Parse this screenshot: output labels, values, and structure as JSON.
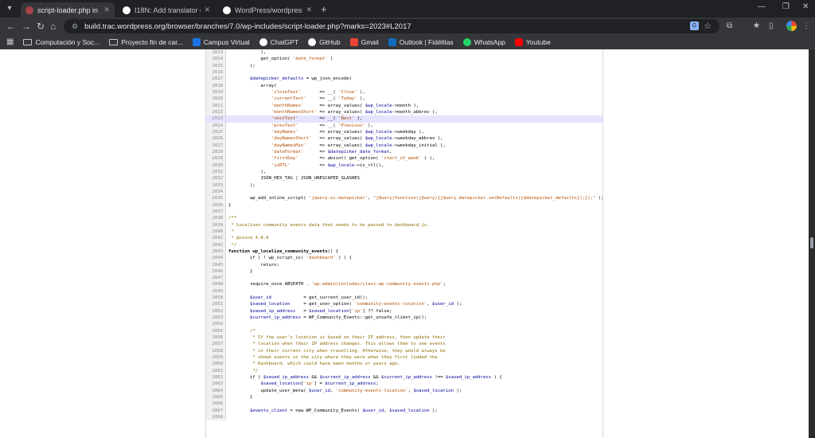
{
  "tabs": [
    {
      "title": "script-loader.php in branches/7.0/wp-includes – WordPress Trac",
      "color": "#a9434a",
      "active": true
    },
    {
      "title": "I18N: Add translator context for datepicker",
      "color": "#ffffff",
      "active": false
    },
    {
      "title": "WordPress/wordpress-develop",
      "color": "#ffffff",
      "active": false
    }
  ],
  "address": {
    "url": "build.trac.wordpress.org/browser/branches/7.0/wp-includes/script-loader.php?marks=2023#L2017"
  },
  "bookmarks": [
    {
      "label": "Computación y Soc...",
      "icon": "folder-icon"
    },
    {
      "label": "Proyecto fin de car...",
      "icon": "folder-icon"
    },
    {
      "label": "Campus Virtual",
      "icon": "campus-icon",
      "color": "#1a73e8"
    },
    {
      "label": "ChatGPT",
      "icon": "chatgpt-icon",
      "color": "#ffffff"
    },
    {
      "label": "GitHub",
      "icon": "github-icon",
      "color": "#ffffff"
    },
    {
      "label": "Gmail",
      "icon": "gmail-icon",
      "color": "#ea4335"
    },
    {
      "label": "Outlook | Fidélitas",
      "icon": "outlook-icon",
      "color": "#0f6cbd"
    },
    {
      "label": "WhatsApp",
      "icon": "whatsapp-icon",
      "color": "#25d366"
    },
    {
      "label": "Youtube",
      "icon": "youtube-icon",
      "color": "#ff0000"
    }
  ],
  "highlight_line": "2023",
  "code": [
    {
      "n": "2013",
      "html": "\t\t\t),"
    },
    {
      "n": "2014",
      "html": "\t\t\tget_option( <span class='str'>'date_format'</span> )"
    },
    {
      "n": "2015",
      "html": "\t\t);"
    },
    {
      "n": "2016",
      "html": ""
    },
    {
      "n": "2017",
      "html": "\t\t<span class='var'>$datepicker_defaults</span> = wp_json_encode("
    },
    {
      "n": "2018",
      "html": "\t\t\tarray("
    },
    {
      "n": "2019",
      "html": "\t\t\t\t<span class='str'>'closeText'</span>       => __( <span class='str'>'Close'</span> ),"
    },
    {
      "n": "2020",
      "html": "\t\t\t\t<span class='str'>'currentText'</span>     => __( <span class='str'>'Today'</span> ),"
    },
    {
      "n": "2021",
      "html": "\t\t\t\t<span class='str'>'monthNames'</span>      => array_values( <span class='var'>$wp_locale</span>->month ),"
    },
    {
      "n": "2022",
      "html": "\t\t\t\t<span class='str'>'monthNamesShort'</span> => array_values( <span class='var'>$wp_locale</span>->month_abbrev ),"
    },
    {
      "n": "2023",
      "html": "\t\t\t\t<span class='str'>'nextText'</span>        => __( <span class='str'>'Next'</span> ),"
    },
    {
      "n": "2024",
      "html": "\t\t\t\t<span class='str'>'prevText'</span>        => __( <span class='str'>'Previous'</span> ),"
    },
    {
      "n": "2025",
      "html": "\t\t\t\t<span class='str'>'dayNames'</span>        => array_values( <span class='var'>$wp_locale</span>->weekday ),"
    },
    {
      "n": "2026",
      "html": "\t\t\t\t<span class='str'>'dayNamesShort'</span>   => array_values( <span class='var'>$wp_locale</span>->weekday_abbrev ),"
    },
    {
      "n": "2027",
      "html": "\t\t\t\t<span class='str'>'dayNamesMin'</span>     => array_values( <span class='var'>$wp_locale</span>->weekday_initial ),"
    },
    {
      "n": "2028",
      "html": "\t\t\t\t<span class='str'>'dateFormat'</span>      => <span class='var'>$datepicker_date_format</span>,"
    },
    {
      "n": "2029",
      "html": "\t\t\t\t<span class='str'>'firstDay'</span>        => absint( get_option( <span class='str'>'start_of_week'</span> ) ),"
    },
    {
      "n": "2030",
      "html": "\t\t\t\t<span class='str'>'isRTL'</span>           => <span class='var'>$wp_locale</span>->is_rtl(),"
    },
    {
      "n": "2031",
      "html": "\t\t\t),"
    },
    {
      "n": "2032",
      "html": "\t\t\tJSON_HEX_TAG | JSON_UNESCAPED_SLASHES"
    },
    {
      "n": "2033",
      "html": "\t\t);"
    },
    {
      "n": "2034",
      "html": ""
    },
    {
      "n": "2035",
      "html": "\t\twp_add_inline_script( <span class='str'>'jquery-ui-datepicker'</span>, <span class='str'>\"jQuery(function(jQuery){jQuery.datepicker.setDefaults({$datepicker_defaults});});\"</span> );"
    },
    {
      "n": "2036",
      "html": "}"
    },
    {
      "n": "2037",
      "html": ""
    },
    {
      "n": "2038",
      "html": "<span class='cmt'>/**</span>"
    },
    {
      "n": "2039",
      "html": "<span class='cmt'> * Localizes community events data that needs to be passed to dashboard.js.</span>"
    },
    {
      "n": "2040",
      "html": "<span class='cmt'> *</span>"
    },
    {
      "n": "2041",
      "html": "<span class='cmt'> * @since 4.8.0</span>"
    },
    {
      "n": "2042",
      "html": "<span class='cmt'> */</span>"
    },
    {
      "n": "2043",
      "html": "<span class='kw'>function</span> <span class='kw'>wp_localize_community_events</span>() {"
    },
    {
      "n": "2044",
      "html": "\t\tif ( ! wp_script_is( <span class='str'>'dashboard'</span> ) ) {"
    },
    {
      "n": "2045",
      "html": "\t\t\treturn;"
    },
    {
      "n": "2046",
      "html": "\t\t}"
    },
    {
      "n": "2047",
      "html": ""
    },
    {
      "n": "2048",
      "html": "\t\trequire_once ABSPATH . <span class='str'>'wp-admin/includes/class-wp-community-events.php'</span>;"
    },
    {
      "n": "2049",
      "html": ""
    },
    {
      "n": "2050",
      "html": "\t\t<span class='var'>$user_id</span>            = get_current_user_id();"
    },
    {
      "n": "2051",
      "html": "\t\t<span class='var'>$saved_location</span>     = get_user_option( <span class='str'>'community-events-location'</span>, <span class='var'>$user_id</span> );"
    },
    {
      "n": "2052",
      "html": "\t\t<span class='var'>$saved_ip_address</span>   = <span class='var'>$saved_location</span>[<span class='str'>'ip'</span>] ?? false;"
    },
    {
      "n": "2053",
      "html": "\t\t<span class='var'>$current_ip_address</span> = WP_Community_Events::get_unsafe_client_ip();"
    },
    {
      "n": "2054",
      "html": ""
    },
    {
      "n": "2055",
      "html": "\t\t<span class='cmt'>/*</span>"
    },
    {
      "n": "2056",
      "html": "\t\t<span class='cmt'> * If the user's location is based on their IP address, then update their</span>"
    },
    {
      "n": "2057",
      "html": "\t\t<span class='cmt'> * location when their IP address changes. This allows them to see events</span>"
    },
    {
      "n": "2058",
      "html": "\t\t<span class='cmt'> * in their current city when travelling. Otherwise, they would always be</span>"
    },
    {
      "n": "2059",
      "html": "\t\t<span class='cmt'> * shown events in the city where they were when they first loaded the</span>"
    },
    {
      "n": "2060",
      "html": "\t\t<span class='cmt'> * Dashboard, which could have been months or years ago.</span>"
    },
    {
      "n": "2061",
      "html": "\t\t<span class='cmt'> */</span>"
    },
    {
      "n": "2062",
      "html": "\t\tif ( <span class='var'>$saved_ip_address</span> && <span class='var'>$current_ip_address</span> && <span class='var'>$current_ip_address</span> !== <span class='var'>$saved_ip_address</span> ) {"
    },
    {
      "n": "2063",
      "html": "\t\t\t<span class='var'>$saved_location</span>[<span class='str'>'ip'</span>] = <span class='var'>$current_ip_address</span>;"
    },
    {
      "n": "2064",
      "html": "\t\t\tupdate_user_meta( <span class='var'>$user_id</span>, <span class='str'>'community-events-location'</span>, <span class='var'>$saved_location</span> );"
    },
    {
      "n": "2065",
      "html": "\t\t}"
    },
    {
      "n": "2066",
      "html": ""
    },
    {
      "n": "2067",
      "html": "\t\t<span class='var'>$events_client</span> = new WP_Community_Events( <span class='var'>$user_id</span>, <span class='var'>$saved_location</span> );"
    },
    {
      "n": "2068",
      "html": ""
    }
  ]
}
